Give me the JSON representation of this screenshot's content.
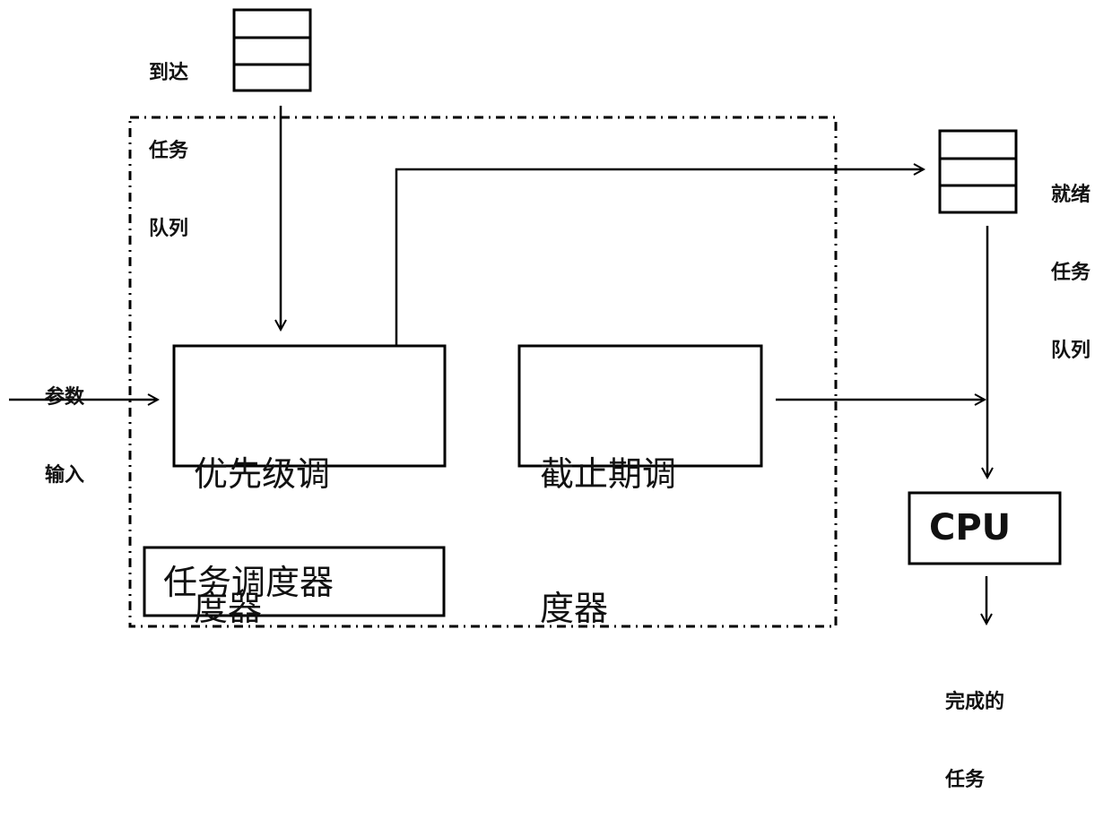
{
  "diagram": {
    "arrival_queue": {
      "label_lines": [
        "到达",
        "任务",
        "队列"
      ],
      "slots": 3
    },
    "ready_queue": {
      "label_lines": [
        "就绪",
        "任务",
        "队列"
      ],
      "slots": 3
    },
    "param_input": {
      "label_lines": [
        "参数",
        "输入"
      ]
    },
    "priority_scheduler": {
      "label_lines": [
        "优先级调",
        "度器"
      ]
    },
    "deadline_scheduler": {
      "label_lines": [
        "截止期调",
        "度器"
      ]
    },
    "task_scheduler": {
      "label": "任务调度器"
    },
    "cpu": {
      "label": "CPU"
    },
    "completed_tasks": {
      "label_lines": [
        "完成的",
        "任务"
      ]
    },
    "colors": {
      "stroke": "#000000",
      "background": "#ffffff"
    }
  }
}
